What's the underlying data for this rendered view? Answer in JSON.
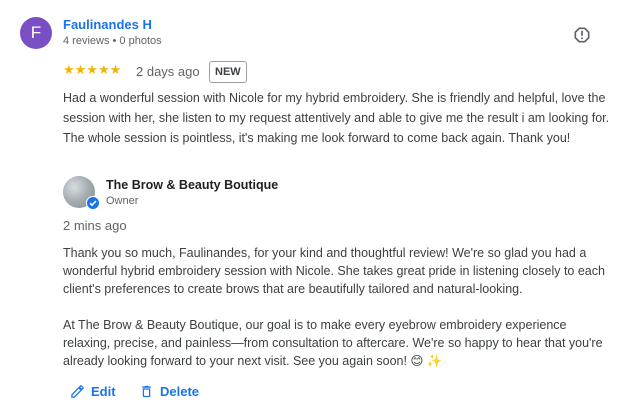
{
  "review": {
    "avatar_letter": "F",
    "reviewer_name": "Faulinandes H",
    "reviewer_meta": "4 reviews • 0 photos",
    "rating": 5,
    "stars": "★★★★★",
    "date": "2 days ago",
    "badge": "NEW",
    "text": "Had a wonderful session with Nicole for my hybrid embroidery. She is friendly and helpful, love the session with her, she listen to my request attentively and able to give me the result i am looking for. The whole session is pointless, it's making me look forward to come back again. Thank you!"
  },
  "reply": {
    "owner_name": "The Brow & Beauty Boutique",
    "owner_role": "Owner",
    "date": "2 mins ago",
    "paragraph1": "Thank you so much, Faulinandes, for your kind and thoughtful review! We're so glad you had a wonderful hybrid embroidery session with Nicole. She takes great pride in listening closely to each client's preferences to create brows that are beautifully tailored and natural-looking.",
    "paragraph2": "At The Brow & Beauty Boutique, our goal is to make every eyebrow embroidery experience relaxing, precise, and painless—from consultation to aftercare. We're so happy to hear that you're already looking forward to your next visit. See you again soon! 😊 ✨"
  },
  "actions": {
    "edit_label": "Edit",
    "delete_label": "Delete"
  },
  "icons": {
    "report": "report-icon",
    "edit": "pencil-icon",
    "delete": "trash-icon",
    "verified": "verified-check-icon"
  },
  "colors": {
    "accent": "#1a73e8",
    "avatar": "#7b4fc4",
    "stars": "#f4b400"
  }
}
